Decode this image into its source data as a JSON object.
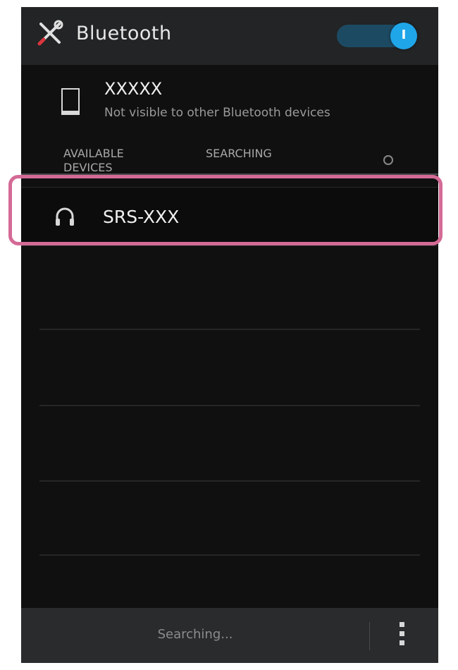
{
  "header": {
    "title": "Bluetooth",
    "settings_icon": "tools-icon",
    "toggle_state_label": "I",
    "toggle_on": true,
    "accent_color": "#1fa6e8"
  },
  "my_device": {
    "icon": "phone-icon",
    "name": "XXXXX",
    "visibility": "Not visible to other Bluetooth devices"
  },
  "available_section": {
    "label": "AVAILABLE DEVICES",
    "status": "SEARCHING",
    "refresh_icon": "refresh-icon"
  },
  "devices": [
    {
      "icon": "headphones-icon",
      "name": "SRS-XXX",
      "highlighted": true
    }
  ],
  "highlight_color": "#d46a96",
  "footer": {
    "status": "Searching...",
    "menu_icon": "overflow-menu-icon"
  }
}
